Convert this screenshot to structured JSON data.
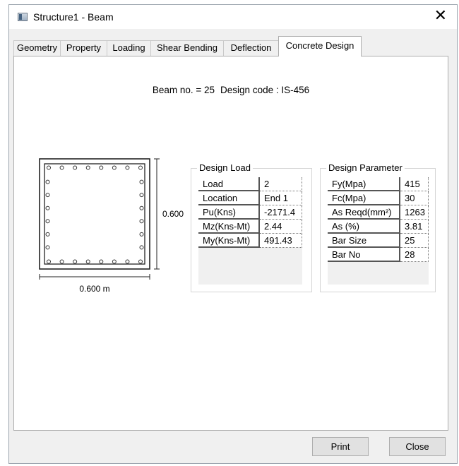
{
  "window": {
    "title": "Structure1 - Beam"
  },
  "tabs": [
    "Geometry",
    "Property",
    "Loading",
    "Shear Bending",
    "Deflection",
    "Concrete Design"
  ],
  "active_tab": "Concrete Design",
  "beam_info": {
    "beam_no": "Beam no. = 25",
    "design_code": "Design code :  IS-456"
  },
  "section": {
    "depth_label": "0.600",
    "width_label": "0.600 m"
  },
  "design_load": {
    "title": "Design Load",
    "rows": [
      {
        "label": "Load",
        "value": "2"
      },
      {
        "label": "Location",
        "value": "End 1"
      },
      {
        "label": "Pu(Kns)",
        "value": "-2171.4"
      },
      {
        "label": "Mz(Kns-Mt)",
        "value": "2.44"
      },
      {
        "label": "My(Kns-Mt)",
        "value": "491.43"
      }
    ]
  },
  "design_parameter": {
    "title": "Design Parameter",
    "rows": [
      {
        "label": "Fy(Mpa)",
        "value": "415"
      },
      {
        "label": "Fc(Mpa)",
        "value": "30"
      },
      {
        "label": "As Reqd(mm²)",
        "value": "1263"
      },
      {
        "label": "As (%)",
        "value": "3.81"
      },
      {
        "label": "Bar Size",
        "value": "25"
      },
      {
        "label": "Bar No",
        "value": "28"
      }
    ]
  },
  "buttons": {
    "print": "Print",
    "close": "Close"
  }
}
